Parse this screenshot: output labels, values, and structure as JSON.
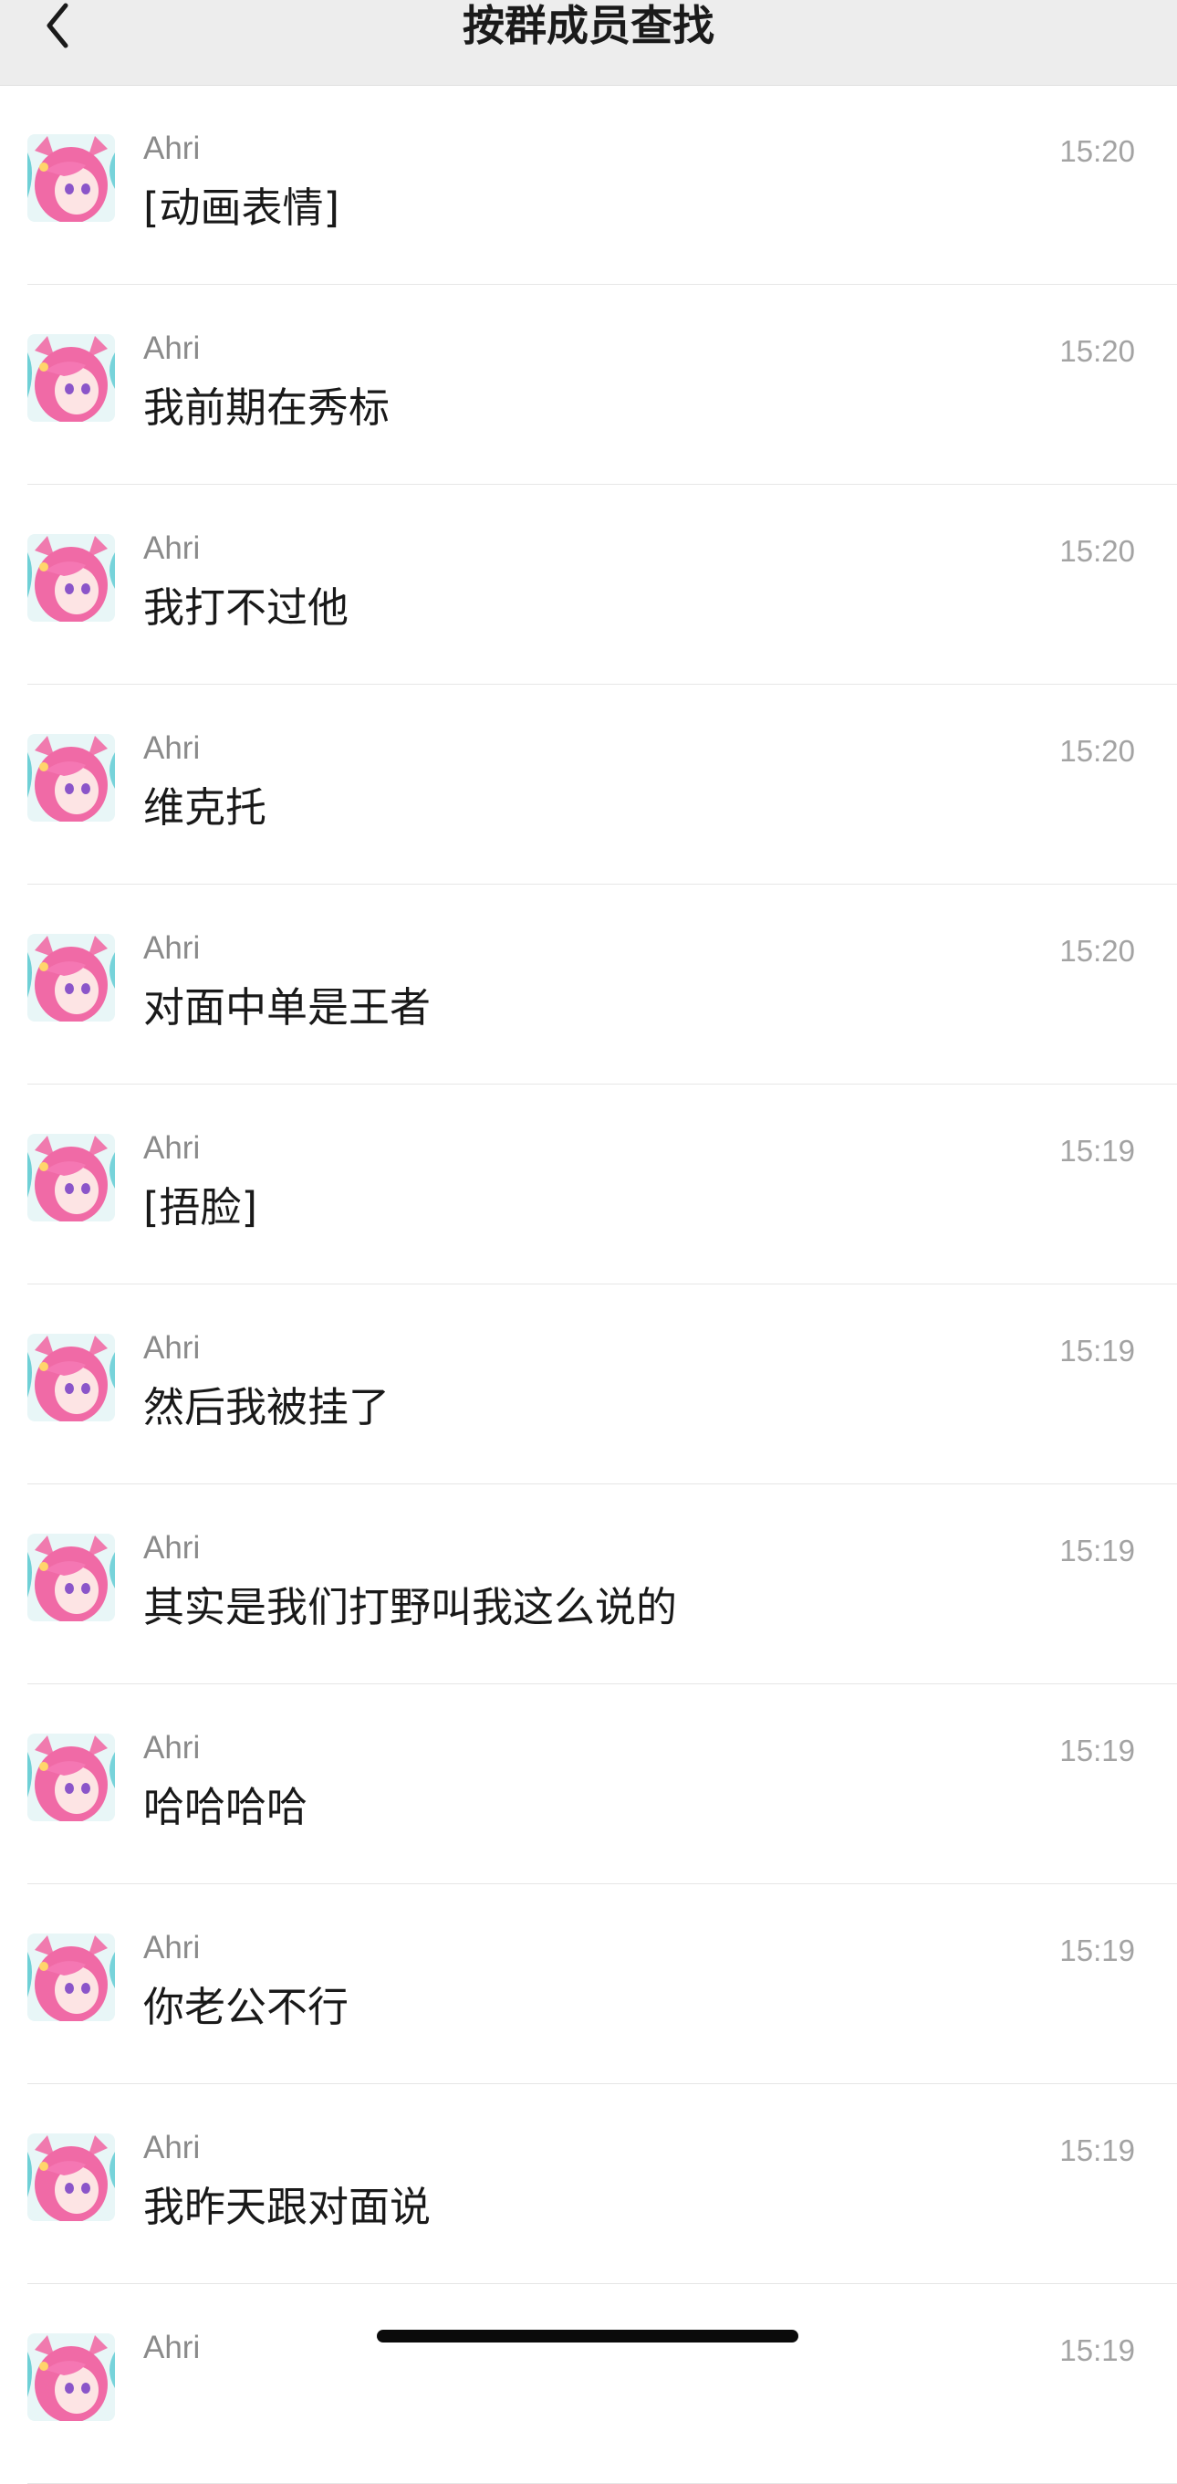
{
  "nav": {
    "title": "按群成员查找",
    "back_icon": "chevron-left-icon"
  },
  "messages": [
    {
      "sender": "Ahri",
      "text": "[动画表情]",
      "time": "15:20"
    },
    {
      "sender": "Ahri",
      "text": "我前期在秀标",
      "time": "15:20"
    },
    {
      "sender": "Ahri",
      "text": "我打不过他",
      "time": "15:20"
    },
    {
      "sender": "Ahri",
      "text": "维克托",
      "time": "15:20"
    },
    {
      "sender": "Ahri",
      "text": "对面中单是王者",
      "time": "15:20"
    },
    {
      "sender": "Ahri",
      "text": "[捂脸]",
      "time": "15:19"
    },
    {
      "sender": "Ahri",
      "text": "然后我被挂了",
      "time": "15:19"
    },
    {
      "sender": "Ahri",
      "text": "其实是我们打野叫我这么说的",
      "time": "15:19"
    },
    {
      "sender": "Ahri",
      "text": "哈哈哈哈",
      "time": "15:19"
    },
    {
      "sender": "Ahri",
      "text": "你老公不行",
      "time": "15:19"
    },
    {
      "sender": "Ahri",
      "text": "我昨天跟对面说",
      "time": "15:19"
    },
    {
      "sender": "Ahri",
      "text": "",
      "time": "15:19"
    }
  ],
  "colors": {
    "nav_bg": "#ededed",
    "sender": "#8a8a8a",
    "message": "#191919",
    "time": "#a3a3a3",
    "avatar_hair": "#f06aa6"
  }
}
